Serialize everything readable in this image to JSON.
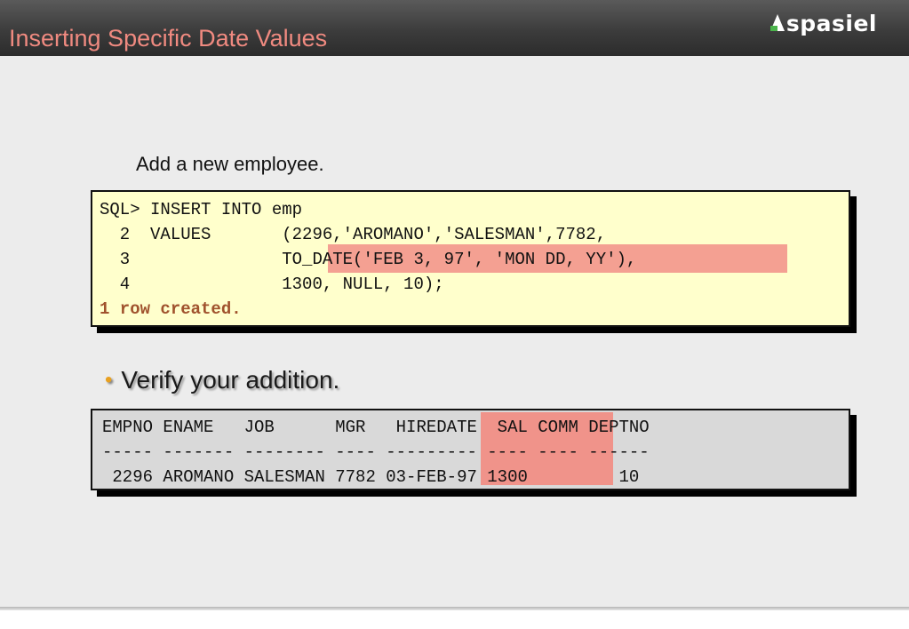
{
  "header": {
    "title": "Inserting Specific Date Values",
    "logo": "spasiel"
  },
  "intro": "Add a new employee.",
  "sql": {
    "lines": [
      "SQL> INSERT INTO emp",
      "  2  VALUES       (2296,'AROMANO','SALESMAN',7782,",
      "  3               TO_DATE('FEB 3, 97', 'MON DD, YY'),",
      "  4               1300, NULL, 10);"
    ],
    "status": "1 row created."
  },
  "bullet": "Verify your addition.",
  "result": {
    "lines": [
      "EMPNO ENAME   JOB      MGR   HIREDATE  SAL COMM DEPTNO",
      "----- ------- -------- ---- --------- ---- ---- ------",
      " 2296 AROMANO SALESMAN 7782 03-FEB-97 1300         10"
    ]
  },
  "colors": {
    "title": "#f08a80",
    "highlight": "#f4a092",
    "sql_background": "#ffffcc",
    "result_background": "#d9d9d9",
    "bullet": "#e8a020"
  }
}
